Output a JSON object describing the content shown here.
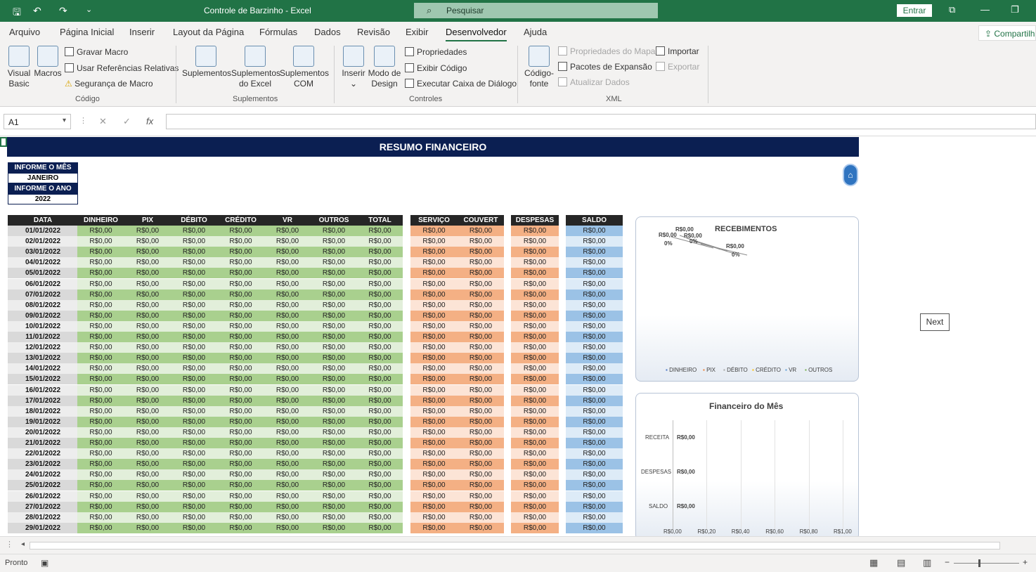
{
  "titlebar": {
    "doc_title": "Controle de Barzinho  -  Excel",
    "search_placeholder": "Pesquisar",
    "signin": "Entrar"
  },
  "tabs": [
    "Arquivo",
    "Página Inicial",
    "Inserir",
    "Layout da Página",
    "Fórmulas",
    "Dados",
    "Revisão",
    "Exibir",
    "Desenvolvedor",
    "Ajuda"
  ],
  "active_tab": "Desenvolvedor",
  "share": "Compartilh",
  "ribbon": {
    "visual_basic": "Visual Basic",
    "macros": "Macros",
    "gravar_macro": "Gravar Macro",
    "usar_ref": "Usar Referências Relativas",
    "seguranca": "Segurança de Macro",
    "group_codigo": "Código",
    "suplementos": "Suplementos",
    "suplementos_excel": "Suplementos do Excel",
    "suplementos_com": "Suplementos COM",
    "group_suplementos": "Suplementos",
    "inserir": "Inserir",
    "modo_design": "Modo de Design",
    "propriedades": "Propriedades",
    "exibir_codigo": "Exibir Código",
    "executar_caixa": "Executar Caixa de Diálogo",
    "group_controles": "Controles",
    "codigo_fonte": "Código-fonte",
    "prop_mapa": "Propriedades do Mapa",
    "pacotes": "Pacotes de Expansão",
    "atualizar": "Atualizar Dados",
    "importar": "Importar",
    "exportar": "Exportar",
    "group_xml": "XML"
  },
  "formula_bar": {
    "name_box": "A1",
    "fx": "fx"
  },
  "sheet": {
    "banner": "RESUMO FINANCEIRO",
    "informe_mes_label": "INFORME O MÊS",
    "informe_mes_value": "JANEIRO",
    "informe_ano_label": "INFORME O ANO",
    "informe_ano_value": "2022",
    "headers": [
      "DATA",
      "DINHEIRO",
      "PIX",
      "DÉBITO",
      "CRÉDITO",
      "VR",
      "OUTROS",
      "TOTAL",
      "SERVIÇO",
      "COUVERT",
      "DESPESAS",
      "SALDO"
    ],
    "dates": [
      "01/01/2022",
      "02/01/2022",
      "03/01/2022",
      "04/01/2022",
      "05/01/2022",
      "06/01/2022",
      "07/01/2022",
      "08/01/2022",
      "09/01/2022",
      "10/01/2022",
      "11/01/2022",
      "12/01/2022",
      "13/01/2022",
      "14/01/2022",
      "15/01/2022",
      "16/01/2022",
      "17/01/2022",
      "18/01/2022",
      "19/01/2022",
      "20/01/2022",
      "21/01/2022",
      "22/01/2022",
      "23/01/2022",
      "24/01/2022",
      "25/01/2022",
      "26/01/2022",
      "27/01/2022",
      "28/01/2022",
      "29/01/2022"
    ],
    "zero": "R$0,00"
  },
  "chart_data": [
    {
      "type": "pie",
      "title": "RECEBIMENTOS",
      "categories": [
        "DINHEIRO",
        "PIX",
        "DÉBITO",
        "CRÉDITO",
        "VR",
        "OUTROS"
      ],
      "values": [
        0,
        0,
        0,
        0,
        0,
        0
      ],
      "data_labels": [
        "R$0,00",
        "0%"
      ],
      "legend": "bottom"
    },
    {
      "type": "bar",
      "title": "Financeiro do Mês",
      "categories": [
        "RECEITA",
        "DESPESAS",
        "SALDO"
      ],
      "values": [
        0,
        0,
        0
      ],
      "value_labels": [
        "R$0,00",
        "R$0,00",
        "R$0,00"
      ],
      "xticks": [
        "R$0,00",
        "R$0,20",
        "R$0,40",
        "R$0,60",
        "R$0,80",
        "R$1,00"
      ],
      "xlim": [
        0,
        1
      ]
    }
  ],
  "next_button": "Next",
  "status": {
    "ready": "Pronto"
  },
  "colors": {
    "excel_green": "#217346",
    "banner": "#0b1f52",
    "green_dark": "#a9d08e",
    "green_light": "#e2efda",
    "orange_dark": "#f4b084",
    "orange_light": "#fce4d6",
    "blue_dark": "#9bc2e6",
    "blue_light": "#ddebf7"
  }
}
